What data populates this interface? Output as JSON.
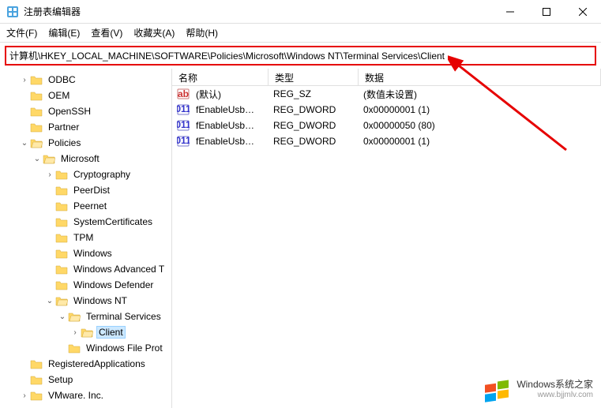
{
  "window": {
    "title": "注册表编辑器"
  },
  "menu": {
    "file": "文件(F)",
    "edit": "编辑(E)",
    "view": "查看(V)",
    "favorites": "收藏夹(A)",
    "help": "帮助(H)"
  },
  "address": "计算机\\HKEY_LOCAL_MACHINE\\SOFTWARE\\Policies\\Microsoft\\Windows NT\\Terminal Services\\Client",
  "tree": {
    "odbc": "ODBC",
    "oem": "OEM",
    "openssh": "OpenSSH",
    "partner": "Partner",
    "policies": "Policies",
    "microsoft": "Microsoft",
    "cryptography": "Cryptography",
    "peerdist": "PeerDist",
    "peernet": "Peernet",
    "systemcertificates": "SystemCertificates",
    "tpm": "TPM",
    "windows": "Windows",
    "windowsadvanced": "Windows Advanced T",
    "windowsdefender": "Windows Defender",
    "windowsnt": "Windows NT",
    "terminalservices": "Terminal Services",
    "client": "Client",
    "windowsfileprot": "Windows File Prot",
    "registeredapplications": "RegisteredApplications",
    "setup": "Setup",
    "vmware": "VMware. Inc."
  },
  "columns": {
    "name": "名称",
    "type": "类型",
    "data": "数据"
  },
  "rows": [
    {
      "name": "(默认)",
      "type": "REG_SZ",
      "data": "(数值未设置)",
      "kind": "sz"
    },
    {
      "name": "fEnableUsbBlo...",
      "type": "REG_DWORD",
      "data": "0x00000001 (1)",
      "kind": "dw"
    },
    {
      "name": "fEnableUsbNo...",
      "type": "REG_DWORD",
      "data": "0x00000050 (80)",
      "kind": "dw"
    },
    {
      "name": "fEnableUsbSel...",
      "type": "REG_DWORD",
      "data": "0x00000001 (1)",
      "kind": "dw"
    }
  ],
  "watermark": {
    "brand": "Windows系统之家",
    "url": "www.bjjmlv.com"
  }
}
